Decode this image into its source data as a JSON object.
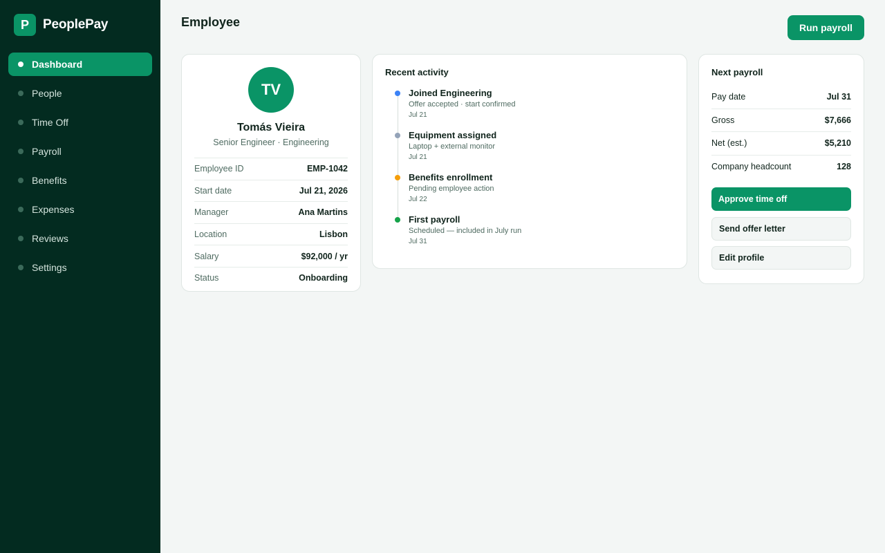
{
  "app": {
    "logo_letter": "P",
    "name": "PeoplePay"
  },
  "sidebar": {
    "items": [
      {
        "label": "Dashboard",
        "active": true
      },
      {
        "label": "People"
      },
      {
        "label": "Time Off"
      },
      {
        "label": "Payroll"
      },
      {
        "label": "Benefits"
      },
      {
        "label": "Expenses"
      },
      {
        "label": "Reviews"
      },
      {
        "label": "Settings"
      }
    ]
  },
  "header": {
    "title": "Employee",
    "run_payroll_label": "Run payroll"
  },
  "profile": {
    "initials": "TV",
    "name": "Tomás Vieira",
    "role": "Senior Engineer · Engineering",
    "fields": [
      {
        "label": "Employee ID",
        "value": "EMP-1042"
      },
      {
        "label": "Start date",
        "value": "Jul 21, 2026"
      },
      {
        "label": "Manager",
        "value": "Ana Martins"
      },
      {
        "label": "Location",
        "value": "Lisbon"
      },
      {
        "label": "Salary",
        "value": "$92,000 / yr"
      },
      {
        "label": "Status",
        "value": "Onboarding"
      }
    ]
  },
  "activity": {
    "title": "Recent activity",
    "items": [
      {
        "title": "Joined Engineering",
        "detail": "Offer accepted · start confirmed",
        "date": "Jul 21",
        "color": "#3b82f6"
      },
      {
        "title": "Equipment assigned",
        "detail": "Laptop + external monitor",
        "date": "Jul 21",
        "color": "#94a3b8"
      },
      {
        "title": "Benefits enrollment",
        "detail": "Pending employee action",
        "date": "Jul 22",
        "color": "#f59e0b"
      },
      {
        "title": "First payroll",
        "detail": "Scheduled — included in July run",
        "date": "Jul 31",
        "color": "#16a34a"
      }
    ]
  },
  "payroll": {
    "title": "Next payroll",
    "rows": [
      {
        "label": "Pay date",
        "value": "Jul 31"
      },
      {
        "label": "Gross",
        "value": "$7,666"
      },
      {
        "label": "Net (est.)",
        "value": "$5,210"
      },
      {
        "label": "Company headcount",
        "value": "128"
      }
    ],
    "actions": {
      "approve_label": "Approve time off",
      "offer_label": "Send offer letter",
      "edit_label": "Edit profile"
    }
  },
  "colors": {
    "accent": "#0a9466",
    "sidebar_bg": "#032b20"
  }
}
